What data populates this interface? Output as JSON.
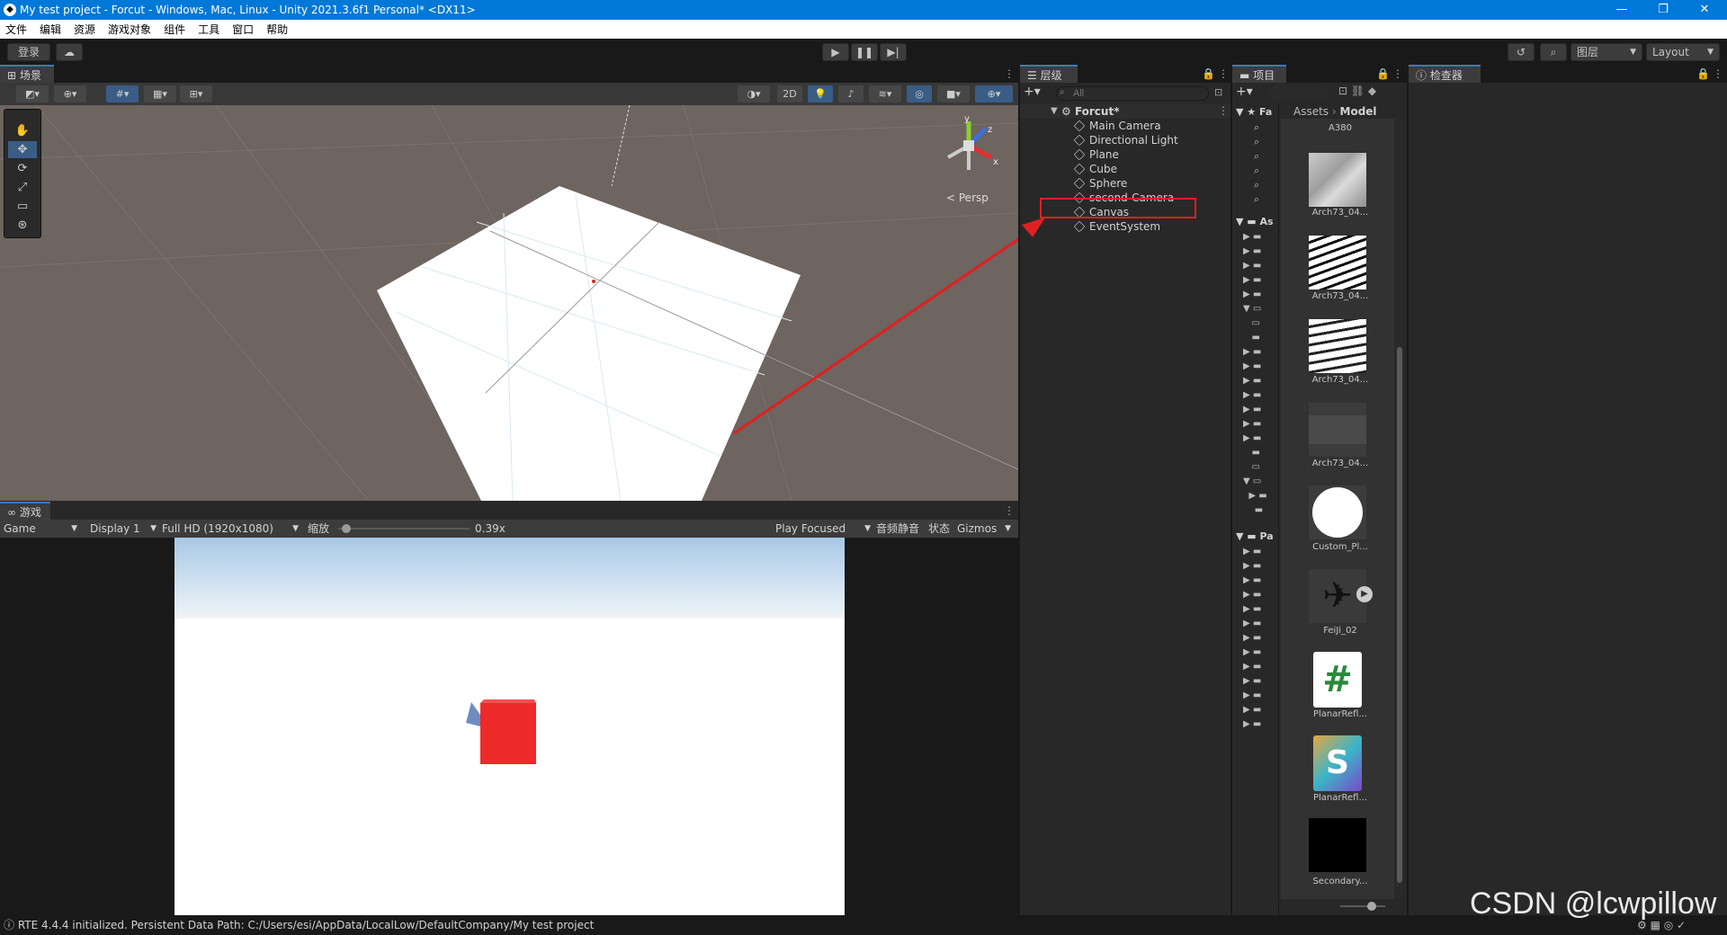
{
  "window": {
    "title": "My test project - Forcut - Windows, Mac, Linux - Unity 2021.3.6f1 Personal* <DX11>"
  },
  "menu": [
    "文件",
    "编辑",
    "资源",
    "游戏对象",
    "组件",
    "工具",
    "窗口",
    "帮助"
  ],
  "toolbar": {
    "login_label": "登录",
    "layers_label": "图层",
    "layout_label": "Layout"
  },
  "scene": {
    "tab_label": "场景",
    "persp_label": "Persp",
    "axis_x": "x",
    "axis_y": "y",
    "axis_z": "z",
    "two_d_label": "2D"
  },
  "game": {
    "tab_label": "游戏",
    "mode": "Game",
    "display": "Display 1",
    "resolution": "Full HD (1920x1080)",
    "zoom_label": "缩放",
    "zoom_value": "0.39x",
    "zoom_fraction": 0.06,
    "play_focused": "Play Focused",
    "mute_label": "音频静音",
    "stats_label": "状态",
    "gizmos_label": "Gizmos"
  },
  "hierarchy": {
    "tab_label": "层级",
    "search_placeholder": "All",
    "scene_name": "Forcut*",
    "items": [
      "Main Camera",
      "Directional Light",
      "Plane",
      "Cube",
      "Sphere",
      "second-Camera",
      "Canvas",
      "EventSystem"
    ],
    "highlighted": "Canvas"
  },
  "project": {
    "tab_label": "项目",
    "favorites_label": "Fa",
    "assets_label": "As",
    "packages_label": "Pa",
    "breadcrumb": [
      "Assets",
      "Model"
    ],
    "items": [
      "A380",
      "Arch73_04...",
      "Arch73_04...",
      "Arch73_04...",
      "Arch73_04...",
      "Custom_Pl...",
      "FeiJi_02",
      "PlanarRefl...",
      "PlanarRefl...",
      "Secondary..."
    ]
  },
  "inspector": {
    "tab_label": "检查器"
  },
  "status": {
    "message": "RTE 4.4.4 initialized. Persistent Data Path: C:/Users/esi/AppData/LocalLow/DefaultCompany/My test project"
  },
  "watermark": "CSDN @lcwpillow",
  "colors": {
    "accent": "#0078d7",
    "highlight_box": "#e02020",
    "arrow": "#e02020",
    "cube": "#ee2a2a"
  }
}
